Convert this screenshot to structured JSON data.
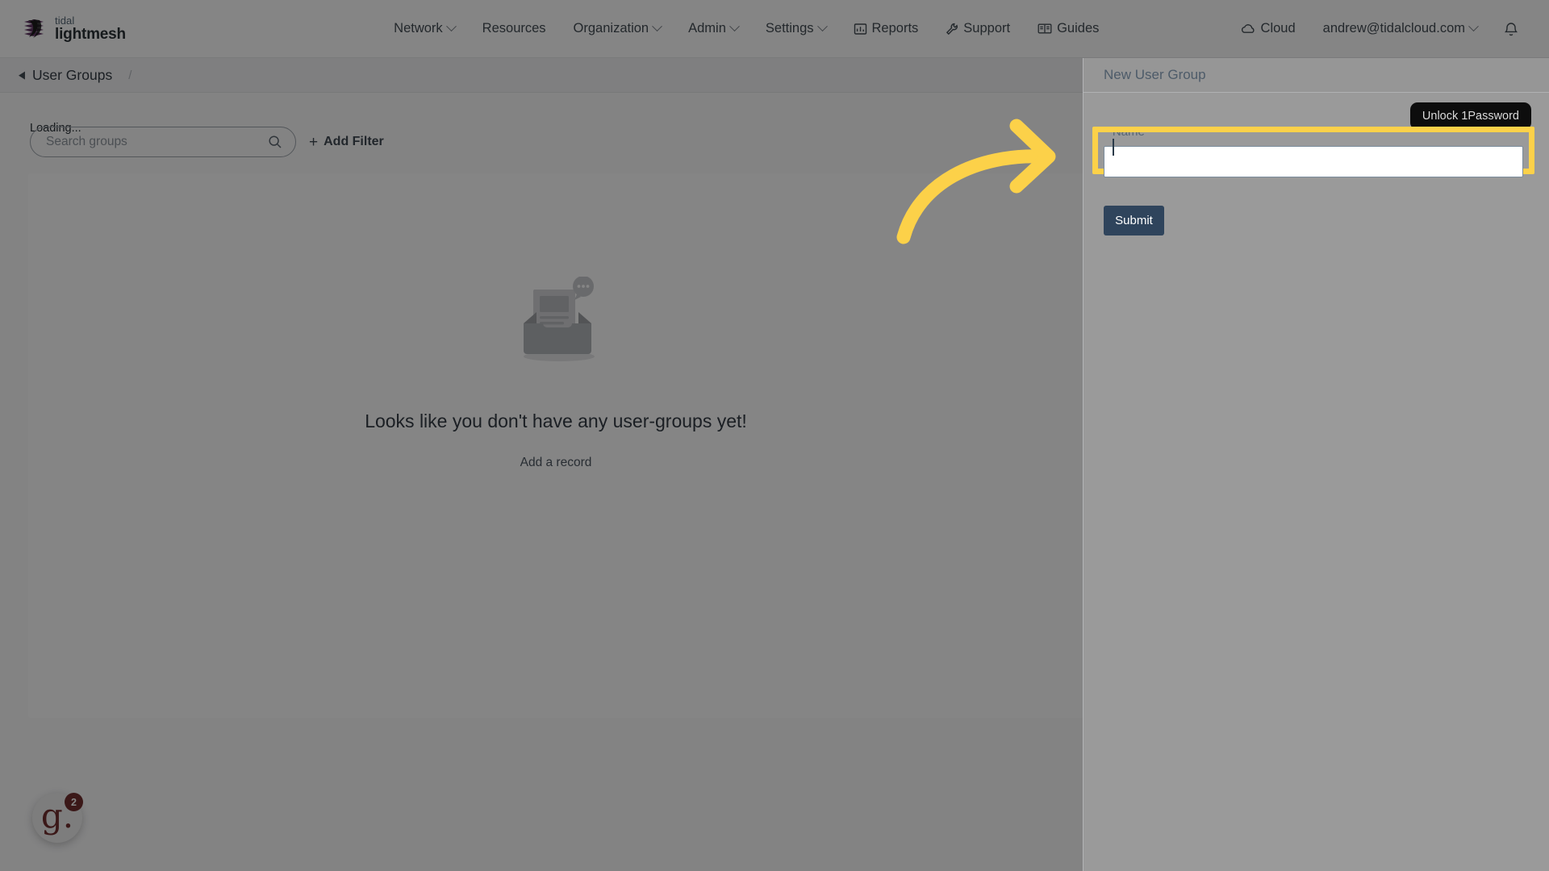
{
  "brand": {
    "name_top": "tidal",
    "name_bottom": "lightmesh",
    "logo_icon": "stacked-layers-logo"
  },
  "topnav": {
    "items": [
      {
        "label": "Network",
        "has_caret": true,
        "icon": ""
      },
      {
        "label": "Resources",
        "has_caret": false,
        "icon": ""
      },
      {
        "label": "Organization",
        "has_caret": true,
        "icon": ""
      },
      {
        "label": "Admin",
        "has_caret": true,
        "icon": ""
      },
      {
        "label": "Settings",
        "has_caret": true,
        "icon": ""
      },
      {
        "label": "Reports",
        "has_caret": false,
        "icon": "bar-chart-icon"
      },
      {
        "label": "Support",
        "has_caret": false,
        "icon": "wrench-icon"
      },
      {
        "label": "Guides",
        "has_caret": false,
        "icon": "book-icon"
      }
    ],
    "cloud_label": "Cloud",
    "cloud_icon": "cloud-icon",
    "user_email": "andrew@tidalcloud.com",
    "user_caret": true,
    "notification_icon": "bell-icon"
  },
  "breadcrumb": {
    "back_icon": "chevron-left-icon",
    "title": "User Groups",
    "separator": "/"
  },
  "toolbar": {
    "loading_text": "Loading...",
    "search_placeholder": "Search groups",
    "search_value": "",
    "search_icon": "search-icon",
    "add_filter_label": "Add Filter",
    "add_filter_plus": "+"
  },
  "empty_state": {
    "illustration": "empty-inbox-icon",
    "title": "Looks like you don't have any user-groups yet!",
    "link_label": "Add a record"
  },
  "chat_widget": {
    "logo_letter": "g.",
    "unread_count": "2"
  },
  "drawer": {
    "title": "New User Group",
    "name_label": "Name",
    "required_marker": "*",
    "name_value": "",
    "submit_label": "Submit"
  },
  "tooltip": {
    "text": "Unlock 1Password"
  },
  "annotation": {
    "arrow_color": "#FCD149",
    "arrow_direction": "curved-right",
    "highlight_color": "#FCD149"
  },
  "colors": {
    "brand_purple": "#7b2d83",
    "brand_dark": "#26323c",
    "submit_bg": "#2f445c",
    "required_red": "#9e4646",
    "chat_red": "#9c2222"
  }
}
